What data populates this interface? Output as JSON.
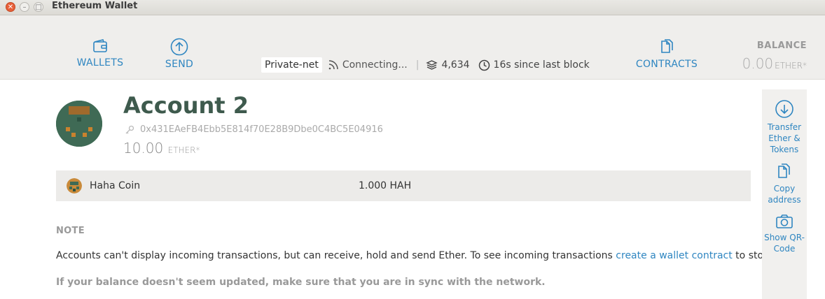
{
  "window": {
    "title": "Ethereum Wallet"
  },
  "nav": {
    "wallets_label": "WALLETS",
    "send_label": "SEND",
    "contracts_label": "CONTRACTS"
  },
  "status": {
    "network": "Private-net",
    "connection": "Connecting...",
    "separator": "|",
    "block_number": "4,634",
    "since_last_block": "16s since last block"
  },
  "balance": {
    "title": "BALANCE",
    "value": "0.00",
    "unit": "ETHER*"
  },
  "account": {
    "name": "Account 2",
    "address": "0x431EAeFB4Ebb5E814f70E28B9Dbe0C4BC5E04916",
    "balance_value": "10.00",
    "balance_unit": "ETHER*"
  },
  "tokens": [
    {
      "name": "Haha Coin",
      "amount": "1.000 HAH"
    }
  ],
  "note": {
    "title": "NOTE",
    "text_before": "Accounts can't display incoming transactions, but can receive, hold and send Ether. To see incoming transactions ",
    "link": "create a wallet contract",
    "text_after": " to store ether.",
    "warning": "If your balance doesn't seem updated, make sure that you are in sync with the network."
  },
  "sidebar": {
    "transfer": [
      "Transfer",
      "Ether &",
      "Tokens"
    ],
    "copy": [
      "Copy",
      "address"
    ],
    "qr": [
      "Show QR-",
      "Code"
    ]
  },
  "colors": {
    "accent": "#2f86c1",
    "account_name": "#3e5a4d",
    "header_bg": "#efeeec"
  }
}
